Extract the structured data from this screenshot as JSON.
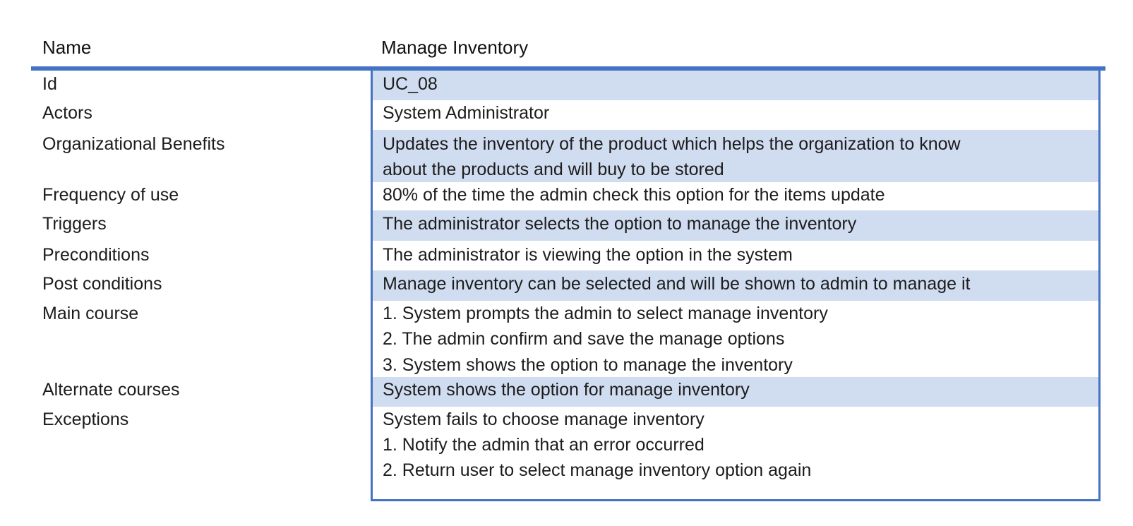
{
  "header": {
    "name_label": "Name",
    "name_value": "Manage Inventory"
  },
  "rows": {
    "id": {
      "label": "Id",
      "value": "UC_08"
    },
    "actors": {
      "label": "Actors",
      "value": "System Administrator"
    },
    "benefits": {
      "label": "Organizational Benefits",
      "value_line1": "Updates the inventory of the product which helps the organization to know",
      "value_line2": "about the products and will buy to be stored"
    },
    "frequency": {
      "label": "Frequency of use",
      "value": "80% of the time the admin check this option for the items update"
    },
    "triggers": {
      "label": "Triggers",
      "value": "The administrator selects the option to manage the inventory"
    },
    "preconditions": {
      "label": "Preconditions",
      "value": "The administrator is viewing the option in the system"
    },
    "postconditions": {
      "label": "Post conditions",
      "value": "Manage inventory can be selected and will be shown to admin to manage it"
    },
    "main_course": {
      "label": "Main course",
      "steps": [
        "1. System prompts the admin to select manage inventory",
        "2. The admin confirm and save the manage options",
        "3. System shows the option to manage the inventory"
      ]
    },
    "alternate": {
      "label": "Alternate courses",
      "value": "System shows the option for manage inventory"
    },
    "exceptions": {
      "label": "Exceptions",
      "heading": "System fails to choose manage inventory",
      "steps": [
        "1. Notify the admin that an error occurred",
        "2. Return user to select manage inventory option again"
      ]
    }
  },
  "colors": {
    "accent": "#4472c4",
    "band": "#d0dcf0"
  }
}
